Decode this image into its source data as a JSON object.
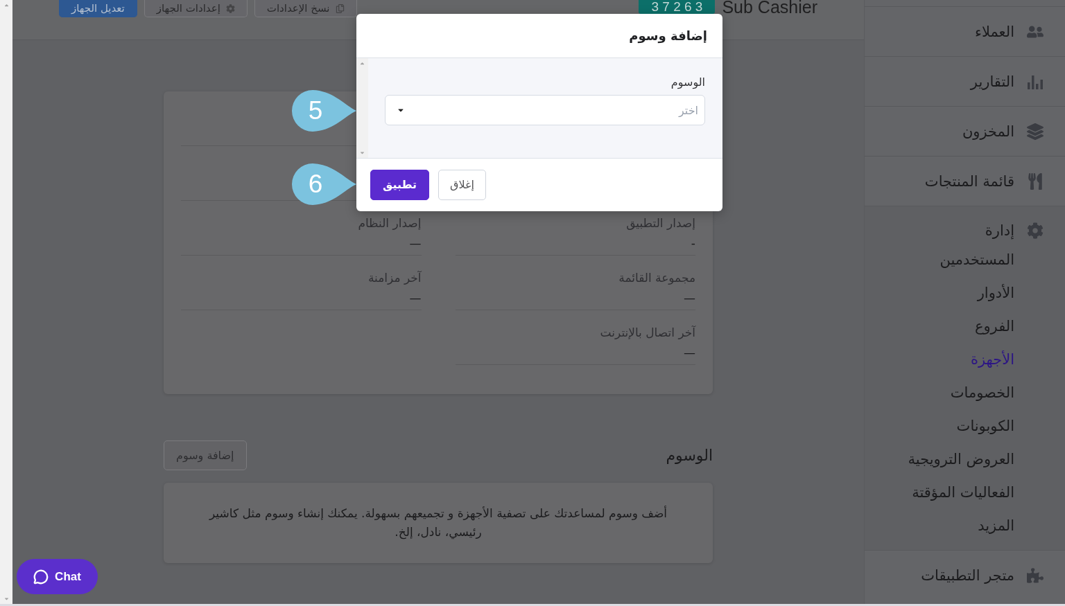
{
  "header": {
    "title": "Sub Cashier",
    "code": "3 7 2 6 3",
    "buttons": [
      {
        "label": "نسخ الإعدادات",
        "kind": "secondary"
      },
      {
        "label": "إعدادات الجهاز",
        "kind": "secondary"
      },
      {
        "label": "تعديل الجهاز",
        "kind": "primary"
      }
    ]
  },
  "sidebar": {
    "items": [
      {
        "kind": "link",
        "label": "العملاء"
      },
      {
        "kind": "link",
        "label": "التقارير"
      },
      {
        "kind": "link",
        "label": "المخزون"
      },
      {
        "kind": "link",
        "label": "قائمة المنتجات"
      },
      {
        "kind": "group",
        "label": "إدارة",
        "expanded": true,
        "children": [
          {
            "label": "المستخدمين",
            "selected": false
          },
          {
            "label": "الأدوار",
            "selected": false
          },
          {
            "label": "الفروع",
            "selected": false
          },
          {
            "label": "الأجهزة",
            "selected": true
          },
          {
            "label": "الخصومات",
            "selected": false
          },
          {
            "label": "الكوبونات",
            "selected": false
          },
          {
            "label": "العروض الترويجية",
            "selected": false
          },
          {
            "label": "الفعاليات المؤقتة",
            "selected": false
          },
          {
            "label": "المزيد",
            "selected": false
          }
        ]
      },
      {
        "kind": "link",
        "label": "متجر التطبيقات"
      }
    ]
  },
  "device_info": {
    "fields": [
      {
        "label": "إصدار التطبيق",
        "value": "-"
      },
      {
        "label": "إصدار النظام",
        "value": "—"
      },
      {
        "label": "مجموعة القائمة",
        "value": "—"
      },
      {
        "label": "آخر مزامنة",
        "value": "—"
      },
      {
        "label": "آخر اتصال بالإنترنت",
        "value": "—"
      }
    ]
  },
  "tags": {
    "title": "الوسوم",
    "add_button": "إضافة وسوم",
    "empty_text": "أضف وسوم لمساعدتك على تصفية الأجهزة و تجميعهم بسهولة. يمكنك إنشاء وسوم مثل كاشير رئيسي، نادل، إلخ."
  },
  "modal": {
    "title": "إضافة وسوم",
    "field_label": "الوسوم",
    "select": {
      "placeholder": "اختر"
    },
    "buttons": [
      {
        "label": "إغلاق",
        "kind": "secondary"
      },
      {
        "label": "تطبيق",
        "kind": "primary"
      }
    ]
  },
  "step_markers": [
    {
      "label": "5"
    },
    {
      "label": "6"
    }
  ],
  "chat_button": {
    "label": "Chat"
  }
}
